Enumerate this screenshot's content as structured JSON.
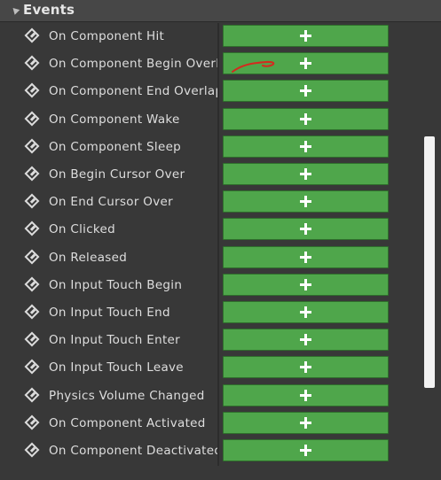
{
  "section": {
    "title": "Events",
    "expanded": true
  },
  "events": [
    {
      "label": "On Component Hit"
    },
    {
      "label": "On Component Begin Overlap"
    },
    {
      "label": "On Component End Overlap"
    },
    {
      "label": "On Component Wake"
    },
    {
      "label": "On Component Sleep"
    },
    {
      "label": "On Begin Cursor Over"
    },
    {
      "label": "On End Cursor Over"
    },
    {
      "label": "On Clicked"
    },
    {
      "label": "On Released"
    },
    {
      "label": "On Input Touch Begin"
    },
    {
      "label": "On Input Touch End"
    },
    {
      "label": "On Input Touch Enter"
    },
    {
      "label": "On Input Touch Leave"
    },
    {
      "label": "Physics Volume Changed"
    },
    {
      "label": "On Component Activated"
    },
    {
      "label": "On Component Deactivated"
    }
  ],
  "icons": {
    "event": "event-diamond-icon",
    "add": "plus-icon",
    "collapse": "collapse-arrow-icon"
  },
  "colors": {
    "panel_bg": "#383838",
    "header_bg": "#474747",
    "add_button": "#4fa64b",
    "annotation_stroke": "#d42a1e"
  }
}
